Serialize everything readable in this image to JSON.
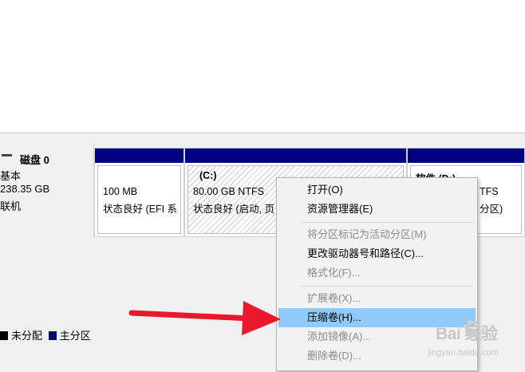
{
  "disk": {
    "name": "磁盘 0",
    "type": "基本",
    "size": "238.35 GB",
    "status": "联机"
  },
  "partitions": [
    {
      "label": "",
      "size": "100 MB",
      "status": "状态良好 (EFI 系"
    },
    {
      "label": "(C:)",
      "size": "80.00 GB NTFS",
      "status": "状态良好 (启动, 页"
    },
    {
      "label": "软件 (D:)",
      "size": "TFS",
      "status": "分区)"
    }
  ],
  "legend": {
    "unallocated": "未分配",
    "primary": "主分区",
    "unallocated_color": "#000000",
    "primary_color": "#000080"
  },
  "context_menu": {
    "items": [
      {
        "label": "打开(O)",
        "enabled": true
      },
      {
        "label": "资源管理器(E)",
        "enabled": true
      },
      {
        "label": "将分区标记为活动分区(M)",
        "enabled": false
      },
      {
        "label": "更改驱动器号和路径(C)...",
        "enabled": true
      },
      {
        "label": "格式化(F)...",
        "enabled": false
      },
      {
        "label": "扩展卷(X)...",
        "enabled": false
      },
      {
        "label": "压缩卷(H)...",
        "enabled": true,
        "highlighted": true
      },
      {
        "label": "添加镜像(A)...",
        "enabled": false
      },
      {
        "label": "删除卷(D)...",
        "enabled": false
      }
    ]
  },
  "annotation": {
    "arrow_color": "#e8192c"
  },
  "watermark": {
    "text": "Bai 经验",
    "url": "jingyan.baidu.com"
  },
  "icons": {
    "disk": "disk-icon",
    "paw": "baidu-paw-icon"
  }
}
